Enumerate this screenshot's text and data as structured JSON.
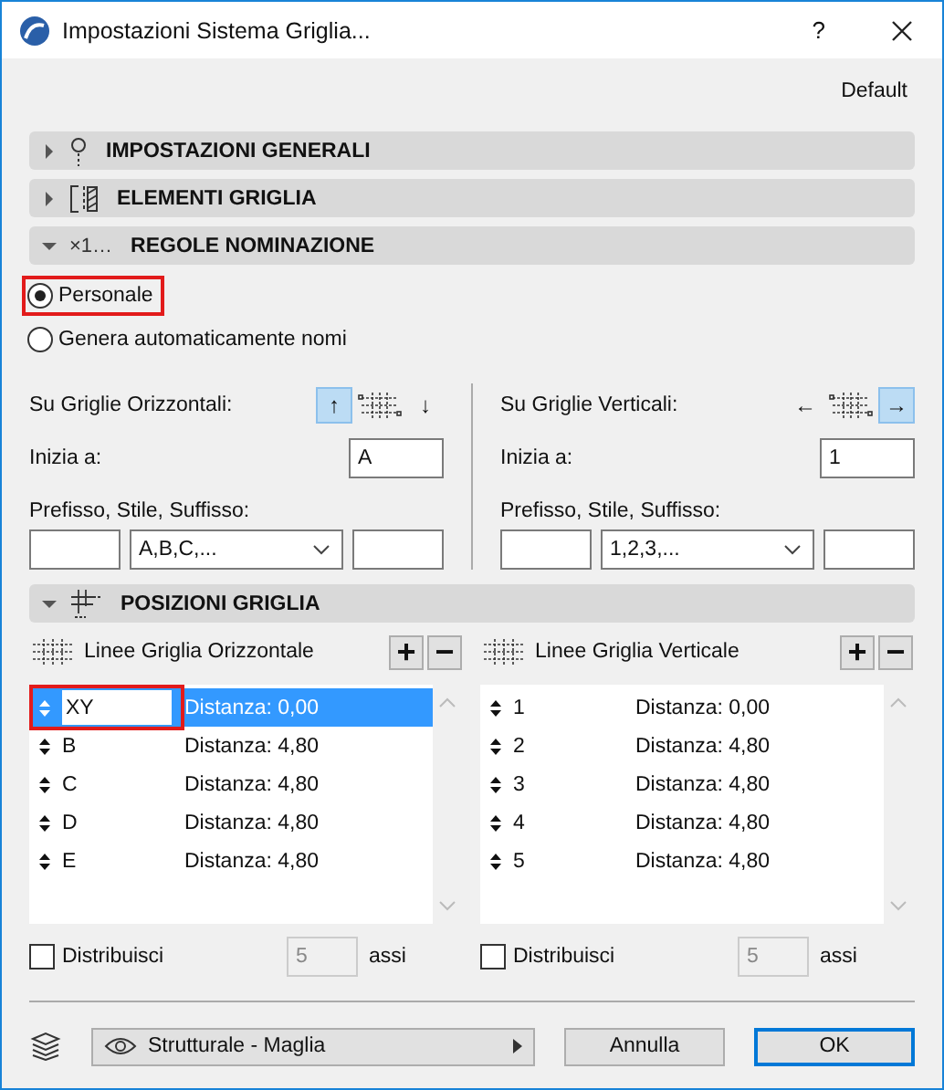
{
  "window": {
    "title": "Impostazioni Sistema Griglia...",
    "help": "?"
  },
  "preset": "Default",
  "general_settings": {
    "title": "IMPOSTAZIONI GENERALI",
    "expanded": false
  },
  "grid_elements": {
    "title": "ELEMENTI GRIGLIA",
    "expanded": false
  },
  "naming_rules": {
    "title": "REGOLE NOMINAZIONE",
    "icon_label": "×1…",
    "expanded": true,
    "options": [
      {
        "label": "Personale",
        "selected": true,
        "highlighted": true
      },
      {
        "label": "Genera automaticamente nomi",
        "selected": false,
        "highlighted": false
      }
    ],
    "columns": [
      {
        "label": "Su Griglie Orizzontali:",
        "arrows": [
          {
            "glyph": "↑",
            "selected": true
          },
          {
            "glyph": "↓",
            "selected": false
          }
        ],
        "start_label": "Inizia a:",
        "start_value": "A",
        "format_label": "Prefisso, Stile, Suffisso:",
        "style": "A,B,C,..."
      },
      {
        "label": "Su Griglie Verticali:",
        "arrows": [
          {
            "glyph": "←",
            "selected": false
          },
          {
            "glyph": "→",
            "selected": true
          }
        ],
        "start_label": "Inizia a:",
        "start_value": "1",
        "format_label": "Prefisso, Stile, Suffisso:",
        "style": "1,2,3,..."
      }
    ]
  },
  "grid_positions": {
    "title": "POSIZIONI GRIGLIA",
    "expanded": true,
    "columns": [
      {
        "title": "Linee Griglia Orizzontale",
        "add": "+",
        "remove": "−",
        "rows": [
          {
            "name": "XY",
            "distance": "Distanza: 0,00",
            "selected": true,
            "highlighted": true
          },
          {
            "name": "B",
            "distance": "Distanza: 4,80",
            "selected": false,
            "highlighted": false
          },
          {
            "name": "C",
            "distance": "Distanza: 4,80",
            "selected": false,
            "highlighted": false
          },
          {
            "name": "D",
            "distance": "Distanza: 4,80",
            "selected": false,
            "highlighted": false
          },
          {
            "name": "E",
            "distance": "Distanza: 4,80",
            "selected": false,
            "highlighted": false
          }
        ],
        "distribute": {
          "label": "Distribuisci",
          "checked": false,
          "count": "5",
          "unit": "assi"
        }
      },
      {
        "title": "Linee Griglia Verticale",
        "add": "+",
        "remove": "−",
        "rows": [
          {
            "name": "1",
            "distance": "Distanza: 0,00",
            "selected": false,
            "highlighted": false
          },
          {
            "name": "2",
            "distance": "Distanza: 4,80",
            "selected": false,
            "highlighted": false
          },
          {
            "name": "3",
            "distance": "Distanza: 4,80",
            "selected": false,
            "highlighted": false
          },
          {
            "name": "4",
            "distance": "Distanza: 4,80",
            "selected": false,
            "highlighted": false
          },
          {
            "name": "5",
            "distance": "Distanza: 4,80",
            "selected": false,
            "highlighted": false
          }
        ],
        "distribute": {
          "label": "Distribuisci",
          "checked": false,
          "count": "5",
          "unit": "assi"
        }
      }
    ]
  },
  "footer": {
    "layer": "Strutturale - Maglia",
    "buttons": [
      {
        "label": "Annulla",
        "default": false
      },
      {
        "label": "OK",
        "default": true
      }
    ]
  }
}
